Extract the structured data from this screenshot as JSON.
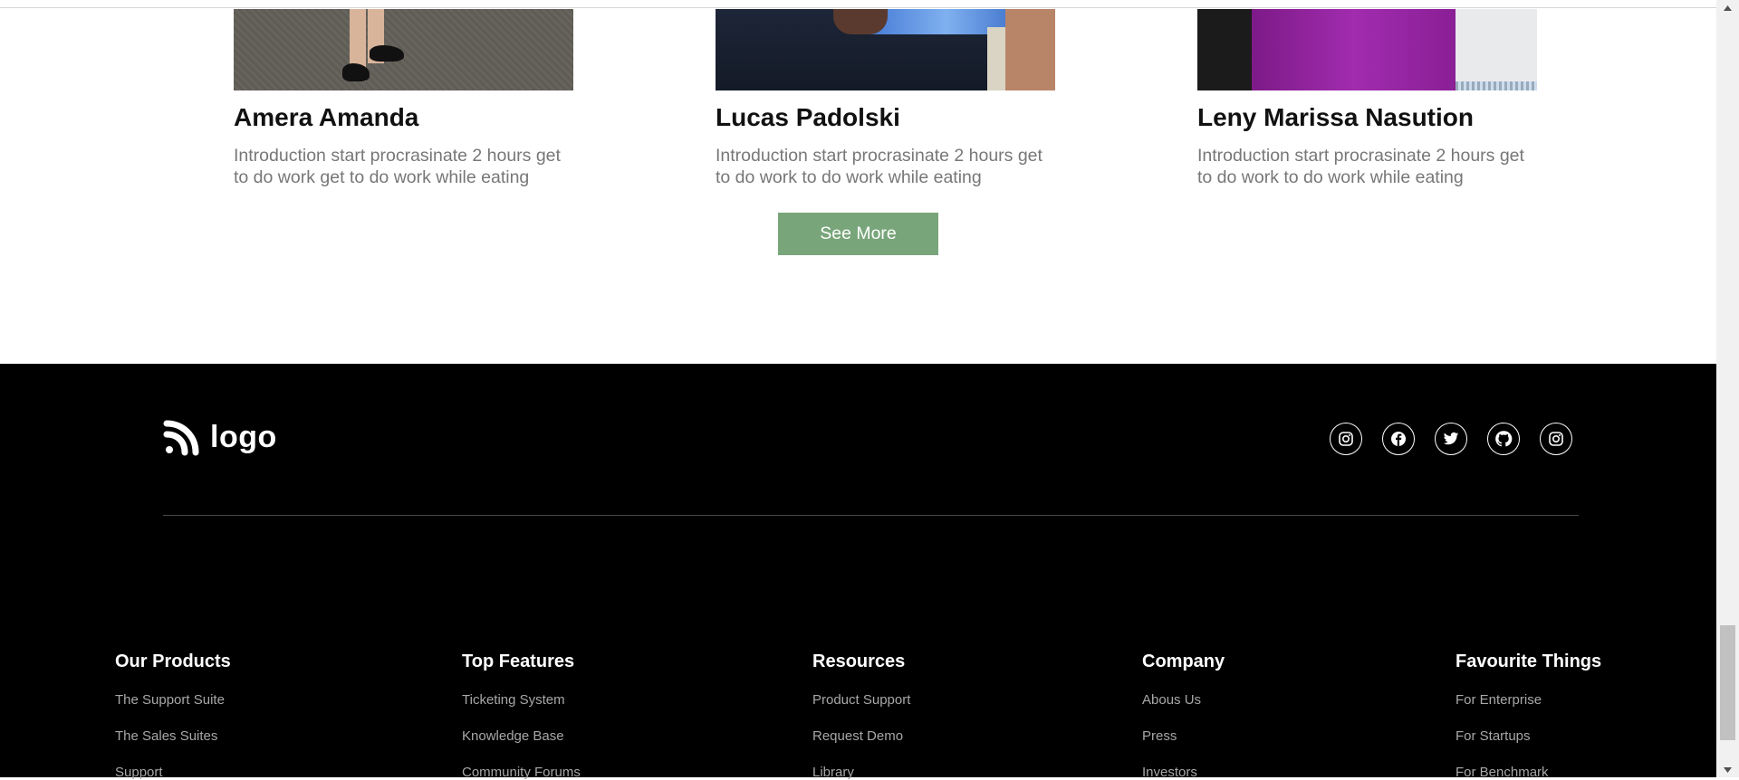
{
  "team": [
    {
      "name": "Amera Amanda",
      "description": "Introduction start procrasinate 2 hours get to do work get to do work while eating"
    },
    {
      "name": "Lucas Padolski",
      "description": "Introduction start procrasinate 2 hours get to do work to do work while eating"
    },
    {
      "name": "Leny Marissa Nasution",
      "description": "Introduction start procrasinate 2 hours get to do work to do work while eating"
    }
  ],
  "see_more_label": "See More",
  "footer": {
    "logo_text": "logo",
    "social_icons": [
      "instagram-icon",
      "facebook-icon",
      "twitter-icon",
      "github-icon",
      "instagram-icon"
    ],
    "columns": [
      {
        "title": "Our Products",
        "links": [
          "The Support Suite",
          "The Sales Suites",
          "Support"
        ]
      },
      {
        "title": "Top Features",
        "links": [
          "Ticketing System",
          "Knowledge Base",
          "Community Forums"
        ]
      },
      {
        "title": "Resources",
        "links": [
          "Product Support",
          "Request Demo",
          "Library"
        ]
      },
      {
        "title": "Company",
        "links": [
          "Abous Us",
          "Press",
          "Investors"
        ]
      },
      {
        "title": "Favourite Things",
        "links": [
          "For Enterprise",
          "For Startups",
          "For Benchmark"
        ]
      }
    ]
  },
  "colors": {
    "accent_button": "#79a57a",
    "footer_bg": "#000000",
    "muted_text": "#777777"
  }
}
